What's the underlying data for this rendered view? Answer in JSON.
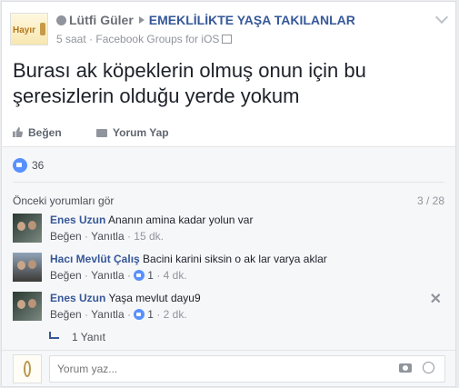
{
  "post": {
    "author": "Lütfi Güler",
    "group": "EMEKLİLİKTE YAŞA TAKILANLAR",
    "page_avatar_text": "Hayır",
    "time": "5 saat",
    "via": "Facebook Groups for iOS",
    "text": "Burası ak köpeklerin olmuş onun için bu şeresizlerin olduğu yerde yokum",
    "actions": {
      "like": "Beğen",
      "comment": "Yorum Yap"
    },
    "like_count": "36"
  },
  "comments_section": {
    "previous_label": "Önceki yorumları gör",
    "count": "3 / 28",
    "comments": [
      {
        "name": "Enes Uzun",
        "text": "Ananın amina kadar yolun var",
        "like": "Beğen",
        "reply": "Yanıtla",
        "likes": "",
        "time": "15 dk."
      },
      {
        "name": "Hacı Mevlüt Çalış",
        "text": "Bacini karini siksin o ak lar varya aklar",
        "like": "Beğen",
        "reply": "Yanıtla",
        "likes": "1",
        "time": "4 dk."
      },
      {
        "name": "Enes Uzun",
        "text": "Yaşa mevlut dayu9",
        "like": "Beğen",
        "reply": "Yanıtla",
        "likes": "1",
        "time": "2 dk."
      }
    ],
    "reply_link": "1 Yanıt"
  },
  "composer": {
    "placeholder": "Yorum yaz..."
  },
  "colors": {
    "link": "#365899",
    "like_blue": "#5890ff",
    "muted": "#90949c"
  },
  "icons": [
    "group-avatar-icon",
    "globe-icon",
    "like-thumb-icon",
    "comment-bubble-icon",
    "like-reaction-icon",
    "reply-arrow-icon",
    "camera-icon",
    "smiley-icon",
    "close-icon",
    "chevron-down-icon"
  ]
}
